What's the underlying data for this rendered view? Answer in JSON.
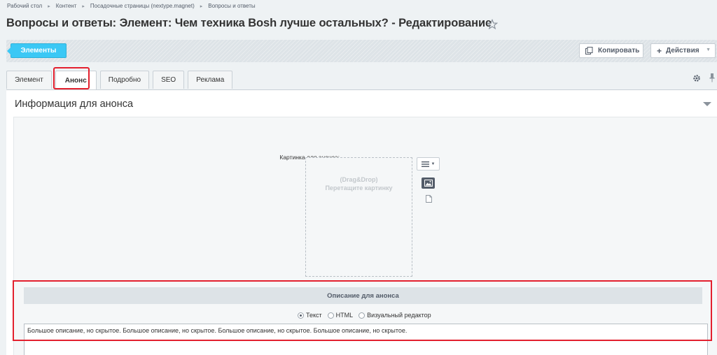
{
  "breadcrumb": [
    "Рабочий стол",
    "Контент",
    "Посадочные страницы (nextype.magnet)",
    "Вопросы и ответы"
  ],
  "page_title": "Вопросы и ответы: Элемент: Чем техника Bosh лучше остальных? - Редактирование",
  "toolbar": {
    "elements_label": "Элементы",
    "copy_label": "Копировать",
    "actions_label": "Действия"
  },
  "tabs": [
    {
      "label": "Элемент",
      "active": false
    },
    {
      "label": "Анонс",
      "active": true
    },
    {
      "label": "Подробно",
      "active": false
    },
    {
      "label": "SEO",
      "active": false
    },
    {
      "label": "Реклама",
      "active": false
    }
  ],
  "section": {
    "title": "Информация для анонса",
    "image_label": "Картинка для анонса:",
    "dropzone_line1": "(Drag&Drop)",
    "dropzone_line2": "Перетащите картинку",
    "description_header": "Описание для анонса",
    "modes": [
      {
        "label": "Текст",
        "checked": true
      },
      {
        "label": "HTML",
        "checked": false
      },
      {
        "label": "Визуальный редактор",
        "checked": false
      }
    ],
    "description_text": "Большое описание, но скрытое. Большое описание, но скрытое. Большое описание, но скрытое. Большое описание, но скрытое."
  },
  "colors": {
    "accent": "#3bc8f5",
    "highlight": "#e3202e",
    "toolbar_bg": "#dde3e7"
  }
}
